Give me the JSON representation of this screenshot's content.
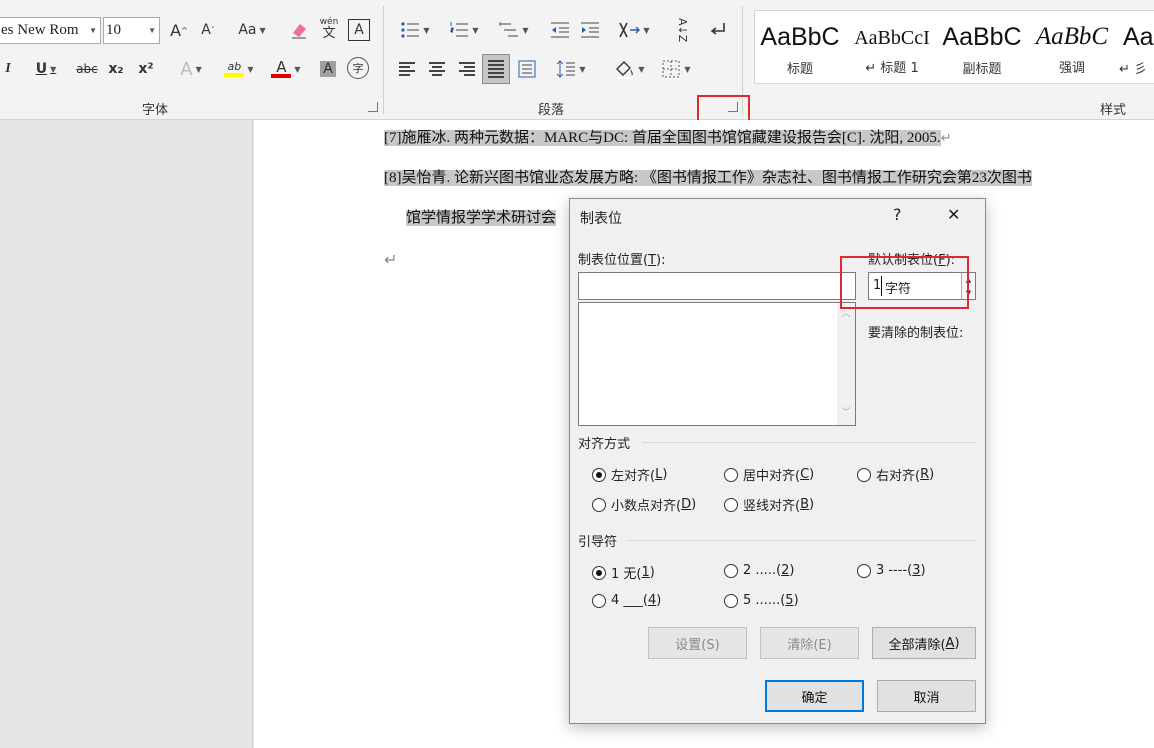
{
  "ribbon": {
    "font_name": "es New Rom",
    "font_size": "10",
    "grow_label": "A",
    "shrink_label": "A",
    "case_label": "Aa",
    "wen_top": "wén",
    "wen_bottom": "文",
    "border_char_label": "A",
    "italic_label": "I",
    "underline_label": "U",
    "strike_label": "abc",
    "sub_label": "x₂",
    "sup_label": "x²",
    "effects_label": "A",
    "highlight_label": "ab",
    "fontcolor_label": "A",
    "shade_label": "A",
    "enclose_label": "字",
    "sort_label": "A↓Z",
    "groups": {
      "font": "字体",
      "paragraph": "段落",
      "styles": "样式"
    },
    "styles": [
      {
        "sample": "AaBbC",
        "name": "标题"
      },
      {
        "sample": "AaBbCcI",
        "name": "↵ 标题 1"
      },
      {
        "sample": "AaBbC",
        "name": "副标题"
      },
      {
        "sample": "AaBbC",
        "name": "强调"
      },
      {
        "sample": "Aa",
        "name": "↵ 彡"
      }
    ],
    "colors": {
      "highlight": "#ffff00",
      "font_color": "#e00000"
    }
  },
  "document": {
    "line1": "[7]施雁冰. 两种元数据：MARC与DC: 首届全国图书馆馆藏建设报告会[C]. 沈阳, 2005.",
    "line2": "[8]吴怡青. 论新兴图书馆业态发展方略: 《图书情报工作》杂志社、图书情报工作研究会第23次图书",
    "line3": "馆学情报学学术研讨会",
    "para_mark": "↵"
  },
  "dialog": {
    "title": "制表位",
    "help": "?",
    "close": "✕",
    "tab_position_label": "制表位位置(",
    "tab_position_key": "T",
    "tab_position_suffix": "):",
    "tab_position_value": "",
    "default_tab_label": "默认制表位(",
    "default_tab_key": "F",
    "default_tab_suffix": "):",
    "default_tab_value": "1",
    "default_tab_unit": "字符",
    "clear_label": "要清除的制表位:",
    "alignment_title": "对齐方式",
    "alignment": [
      {
        "text": "左对齐(",
        "key": "L",
        "checked": true
      },
      {
        "text": "居中对齐(",
        "key": "C",
        "checked": false
      },
      {
        "text": "右对齐(",
        "key": "R",
        "checked": false
      },
      {
        "text": "小数点对齐(",
        "key": "D",
        "checked": false
      },
      {
        "text": "竖线对齐(",
        "key": "B",
        "checked": false
      }
    ],
    "leader_title": "引导符",
    "leader": [
      {
        "text": "1 无(",
        "key": "1",
        "checked": true
      },
      {
        "text": "2 .....(",
        "key": "2",
        "checked": false
      },
      {
        "text": "3 ----(",
        "key": "3",
        "checked": false
      },
      {
        "text": "4 ___(",
        "key": "4",
        "checked": false
      },
      {
        "text": "5 ......(",
        "key": "5",
        "checked": false
      }
    ],
    "set_button": "设置(S)",
    "clear_button": "清除(E)",
    "clear_all_button": "全部清除(",
    "clear_all_key": "A",
    "ok_button": "确定",
    "cancel_button": "取消"
  }
}
